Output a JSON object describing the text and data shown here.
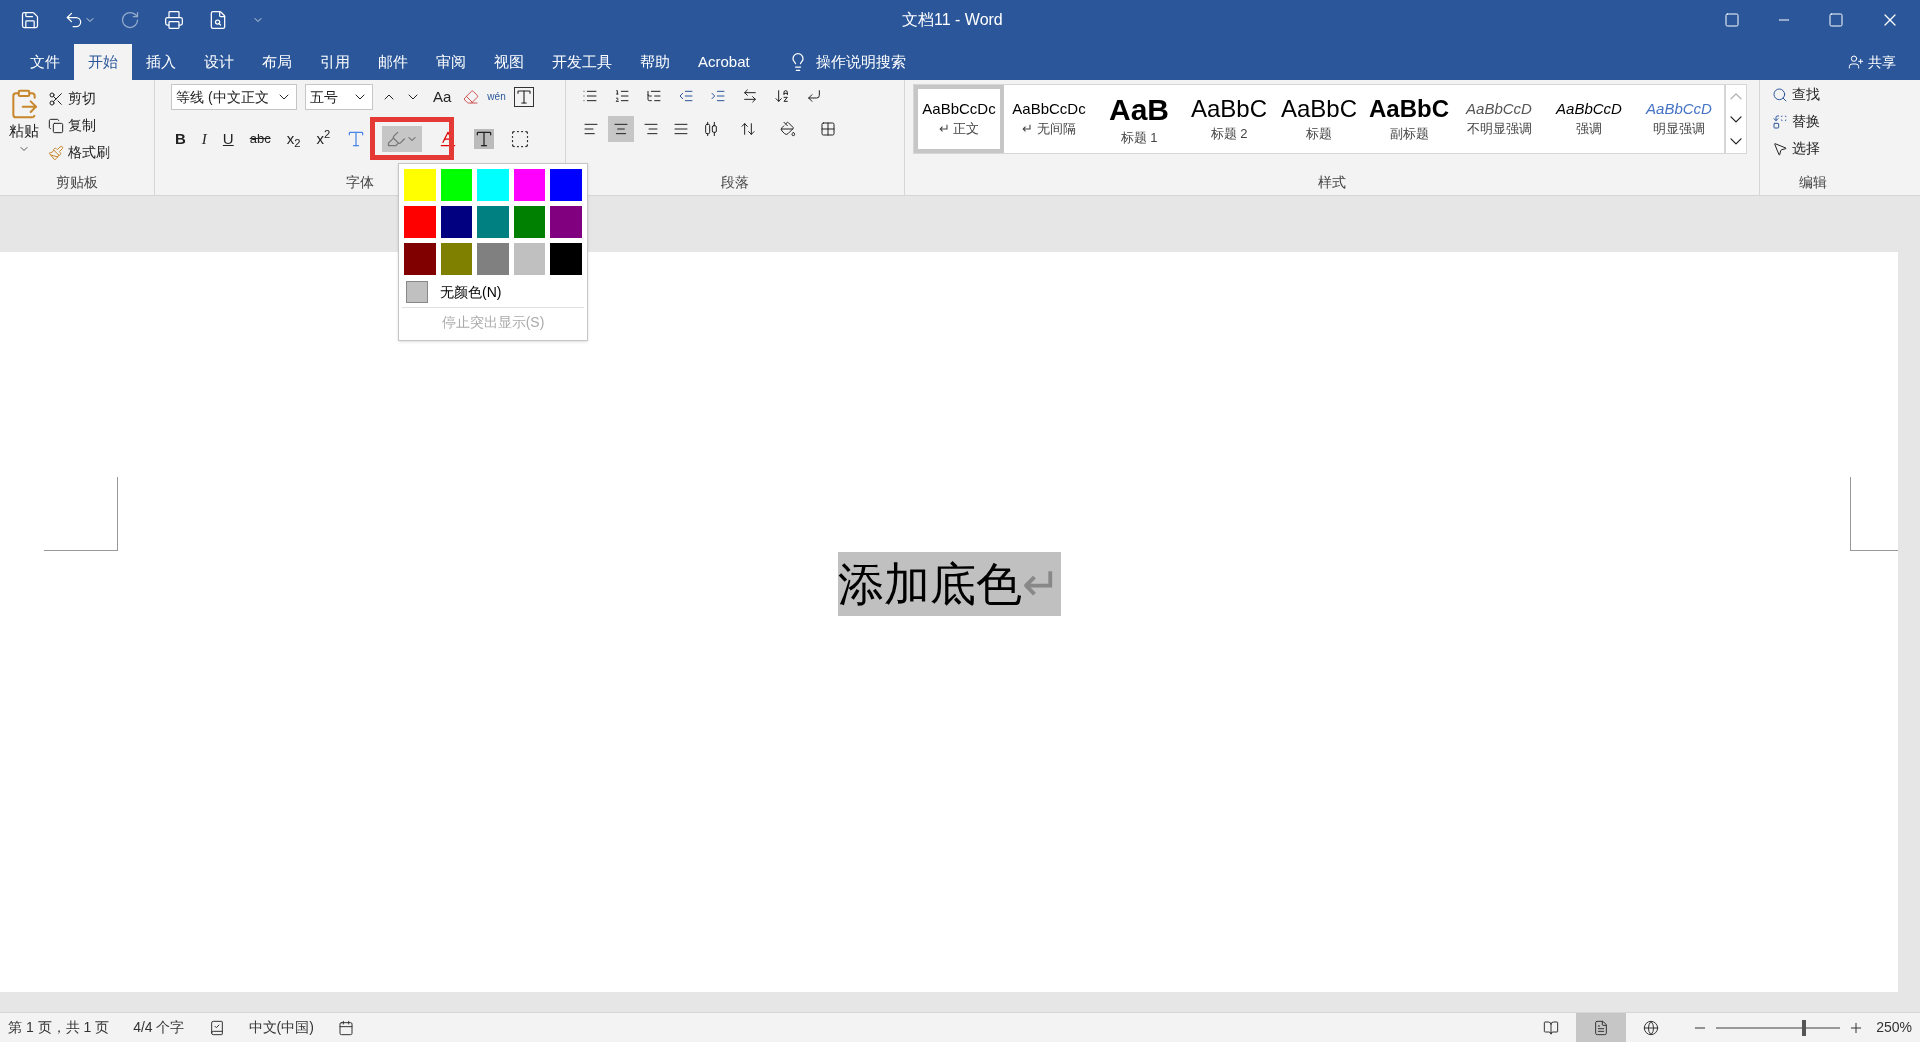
{
  "window": {
    "title": "文档11  -  Word"
  },
  "menu_tabs": [
    {
      "label": "文件",
      "selected": false
    },
    {
      "label": "开始",
      "selected": true
    },
    {
      "label": "插入",
      "selected": false
    },
    {
      "label": "设计",
      "selected": false
    },
    {
      "label": "布局",
      "selected": false
    },
    {
      "label": "引用",
      "selected": false
    },
    {
      "label": "邮件",
      "selected": false
    },
    {
      "label": "审阅",
      "selected": false
    },
    {
      "label": "视图",
      "selected": false
    },
    {
      "label": "开发工具",
      "selected": false
    },
    {
      "label": "帮助",
      "selected": false
    },
    {
      "label": "Acrobat",
      "selected": false
    }
  ],
  "tell_me": "操作说明搜索",
  "share": "共享",
  "clipboard": {
    "group": "剪贴板",
    "paste": "粘贴",
    "cut": "剪切",
    "copy": "复制",
    "format_painter": "格式刷"
  },
  "font": {
    "group": "字体",
    "family": "等线 (中文正文",
    "size": "五号",
    "change_case": "Aa",
    "phonetic": "wén",
    "bold": "B",
    "italic": "I",
    "underline": "U",
    "strike": "abc",
    "subscript": "x$_{2}$",
    "superscript": "x$^{2}$",
    "highlight_open": true
  },
  "paragraph": {
    "group": "段落",
    "align_buttons": [
      {
        "kind": "left",
        "selected": false
      },
      {
        "kind": "center",
        "selected": true
      },
      {
        "kind": "right",
        "selected": false
      },
      {
        "kind": "justify",
        "selected": false
      },
      {
        "kind": "distributed",
        "selected": false
      }
    ]
  },
  "styles": {
    "group": "样式",
    "items": [
      {
        "preview": "AaBbCcDc",
        "name": "↵ 正文",
        "kind": "normal",
        "selected": true
      },
      {
        "preview": "AaBbCcDc",
        "name": "↵ 无间隔",
        "kind": "normal",
        "selected": false
      },
      {
        "preview": "AaB",
        "name": "标题 1",
        "kind": "heading1",
        "selected": false
      },
      {
        "preview": "AaBbC",
        "name": "标题 2",
        "kind": "heading2",
        "selected": false
      },
      {
        "preview": "AaBbC",
        "name": "标题",
        "kind": "title",
        "selected": false
      },
      {
        "preview": "AaBbC",
        "name": "副标题",
        "kind": "subtitle",
        "selected": false
      },
      {
        "preview": "AaBbCcD",
        "name": "不明显强调",
        "kind": "subtle",
        "selected": false
      },
      {
        "preview": "AaBbCcD",
        "name": "强调",
        "kind": "emphasis",
        "selected": false
      },
      {
        "preview": "AaBbCcD",
        "name": "明显强调",
        "kind": "intense",
        "selected": false
      }
    ]
  },
  "editing": {
    "group": "编辑",
    "find": "查找",
    "replace": "替换",
    "select": "选择"
  },
  "highlight_menu": {
    "colors": [
      {
        "color": "#ffff00"
      },
      {
        "color": "#00ff00"
      },
      {
        "color": "#00ffff"
      },
      {
        "color": "#ff00ff"
      },
      {
        "color": "#0000ff"
      },
      {
        "color": "#ff0000"
      },
      {
        "color": "#000080"
      },
      {
        "color": "#008080"
      },
      {
        "color": "#008000"
      },
      {
        "color": "#800080"
      },
      {
        "color": "#800000"
      },
      {
        "color": "#808000"
      },
      {
        "color": "#808080"
      },
      {
        "color": "#c0c0c0"
      },
      {
        "color": "#000000"
      }
    ],
    "no_color": "无颜色(N)",
    "stop": "停止突出显示(S)",
    "stop_disabled": true
  },
  "document": {
    "text": "添加底色",
    "mark": "↵",
    "highlighted": true
  },
  "status_bar": {
    "page": "第 1 页，共 1 页",
    "words": "4/4 个字",
    "language": "中文(中国)",
    "views": [
      {
        "kind": "read",
        "selected": false
      },
      {
        "kind": "print",
        "selected": true
      },
      {
        "kind": "web",
        "selected": false
      }
    ],
    "zoom_slider": {
      "level": 0.69
    },
    "zoom": "250%"
  }
}
